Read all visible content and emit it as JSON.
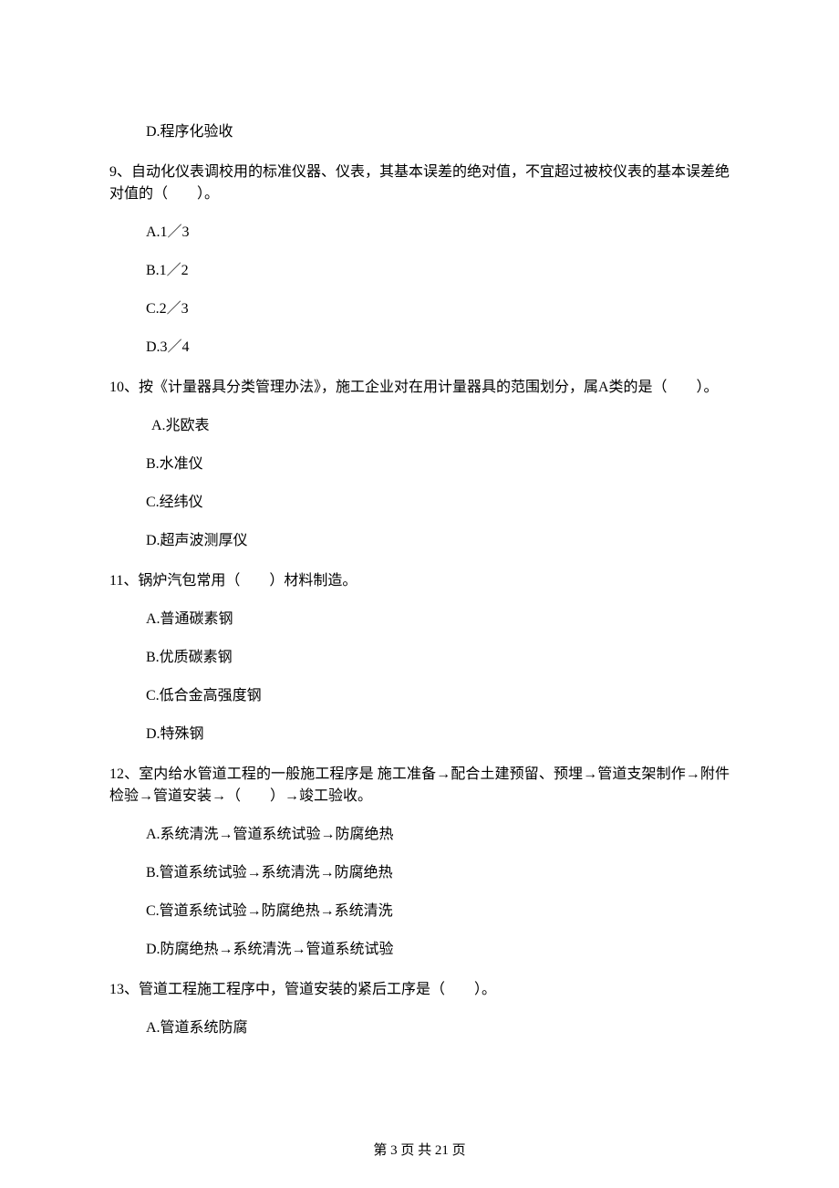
{
  "q8": {
    "options": {
      "D": "D.程序化验收"
    }
  },
  "q9": {
    "stem": "9、自动化仪表调校用的标准仪器、仪表，其基本误差的绝对值，不宜超过被校仪表的基本误差绝对值的（　　）。",
    "options": {
      "A": "A.1／3",
      "B": "B.1／2",
      "C": "C.2／3",
      "D": "D.3／4"
    }
  },
  "q10": {
    "stem": "10、按《计量器具分类管理办法》，施工企业对在用计量器具的范围划分，属A类的是（　　）。",
    "options": {
      "A": "A.兆欧表",
      "B": "B.水准仪",
      "C": "C.经纬仪",
      "D": "D.超声波测厚仪"
    }
  },
  "q11": {
    "stem": "11、锅炉汽包常用（　　）材料制造。",
    "options": {
      "A": "A.普通碳素钢",
      "B": "B.优质碳素钢",
      "C": "C.低合金高强度钢",
      "D": "D.特殊钢"
    }
  },
  "q12": {
    "stem": "12、室内给水管道工程的一般施工程序是 施工准备→配合土建预留、预埋→管道支架制作→附件检验→管道安装→（　　）→竣工验收。",
    "options": {
      "A": "A.系统清洗→管道系统试验→防腐绝热",
      "B": "B.管道系统试验→系统清洗→防腐绝热",
      "C": "C.管道系统试验→防腐绝热→系统清洗",
      "D": "D.防腐绝热→系统清洗→管道系统试验"
    }
  },
  "q13": {
    "stem": "13、管道工程施工程序中，管道安装的紧后工序是（　　）。",
    "options": {
      "A": "A.管道系统防腐"
    }
  },
  "footer": "第 3 页 共 21 页"
}
